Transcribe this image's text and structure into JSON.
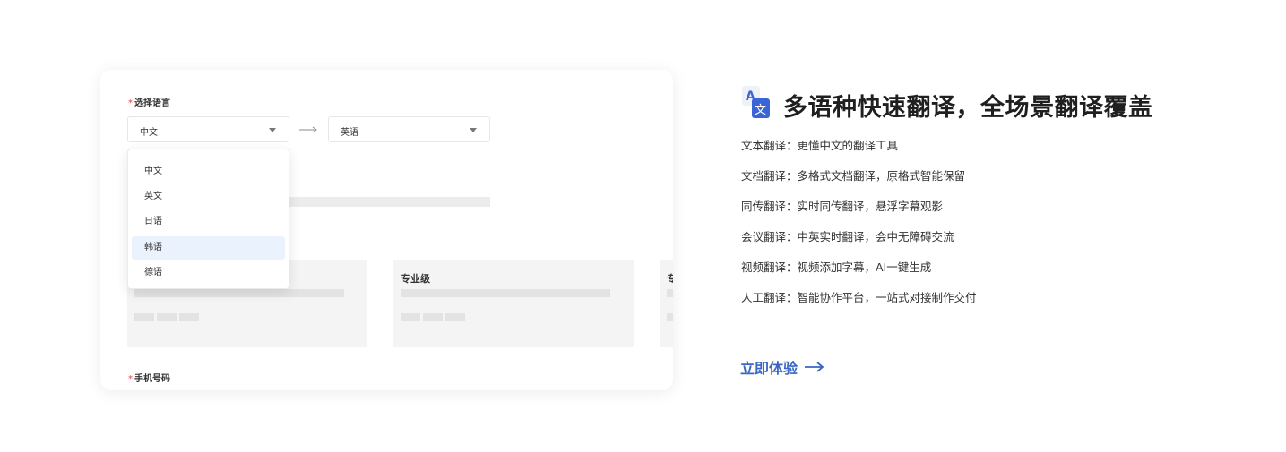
{
  "form": {
    "language_label": "选择语言",
    "source_value": "中文",
    "target_value": "英语",
    "dropdown_options": [
      "中文",
      "英文",
      "日语",
      "韩语",
      "德语"
    ],
    "active_option_index": 3,
    "plan_title_2": "专业级",
    "plan_title_3": "专",
    "phone_label": "手机号码",
    "required_mark": "*"
  },
  "hero": {
    "title": "多语种快速翻译，全场景翻译覆盖",
    "features": [
      "文本翻译：更懂中文的翻译工具",
      "文档翻译：多格式文档翻译，原格式智能保留",
      "同传翻译：实时同传翻译，悬浮字幕观影",
      "会议翻译：中英实时翻译，会中无障碍交流",
      "视频翻译：视频添加字幕，AI一键生成",
      "人工翻译：智能协作平台，一站式对接制作交付"
    ],
    "cta_label": "立即体验",
    "icon_letter_a": "A",
    "icon_letter_wen": "文"
  },
  "colors": {
    "accent": "#3a66c4",
    "required": "#e5484d",
    "dropdown_active_bg": "#eaf2fd",
    "icon_blue": "#3b64d6"
  }
}
